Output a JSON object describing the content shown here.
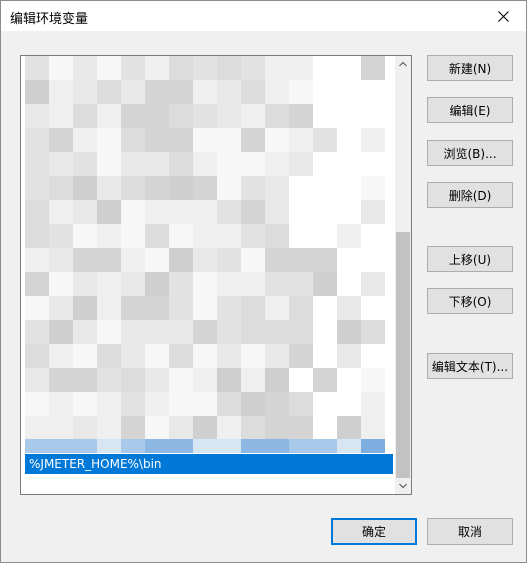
{
  "window": {
    "title": "编辑环境变量",
    "close_icon": "close-icon"
  },
  "list": {
    "selected_item": "%JMETER_HOME%\\bin"
  },
  "buttons": {
    "new": "新建(N)",
    "edit": "编辑(E)",
    "browse": "浏览(B)...",
    "delete": "删除(D)",
    "move_up": "上移(U)",
    "move_down": "下移(O)",
    "edit_text": "编辑文本(T)...",
    "ok": "确定",
    "cancel": "取消"
  },
  "colors": {
    "selection": "#0078d7",
    "button_face": "#e1e1e1",
    "window_bg": "#f0f0f0"
  }
}
